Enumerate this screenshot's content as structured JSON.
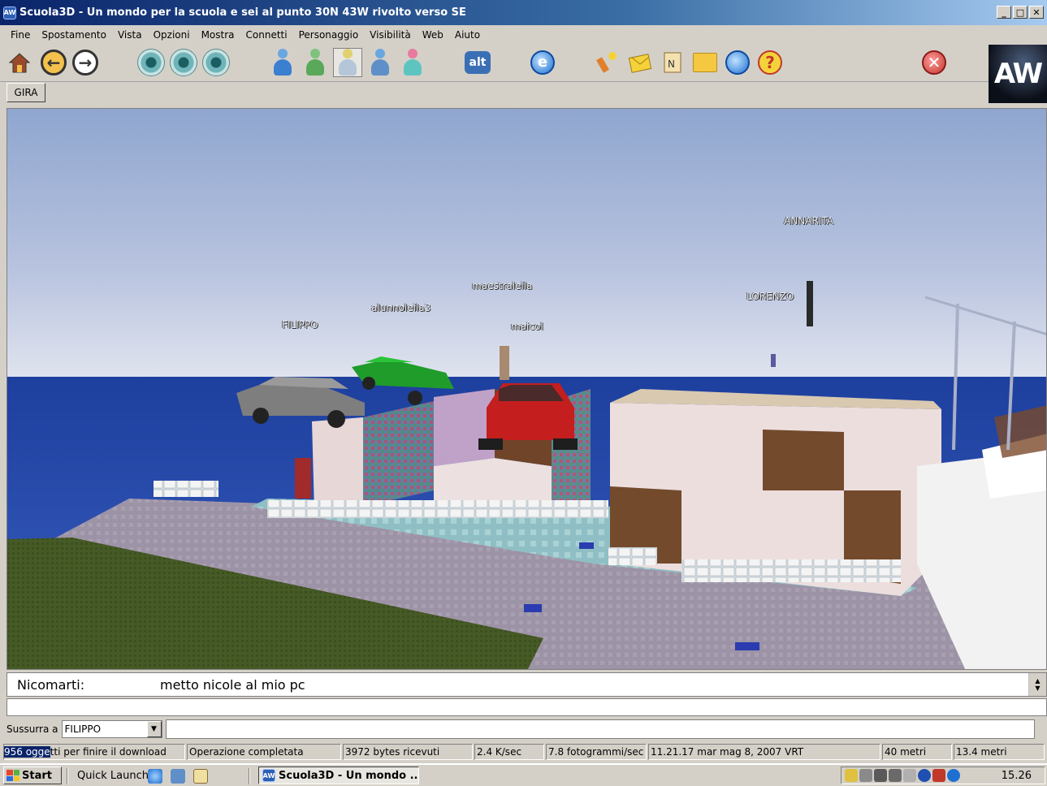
{
  "window": {
    "title": "Scuola3D - Un mondo per la scuola e sei al punto 30N 43W rivolto verso SE",
    "icon_text": "AW",
    "controls": {
      "minimize": "_",
      "maximize": "□",
      "close": "✕"
    }
  },
  "menu": [
    "Fine",
    "Spostamento",
    "Vista",
    "Opzioni",
    "Mostra",
    "Connetti",
    "Personaggio",
    "Visibilità",
    "Web",
    "Aiuto"
  ],
  "toolbar": {
    "icons": [
      "home-icon",
      "back-icon",
      "forward-icon",
      "view-first-person-icon",
      "view-third-person-icon",
      "view-front-icon",
      "avatar-icon",
      "avatar-look-icon",
      "avatar-select-icon",
      "contacts-icon",
      "telegram-icon",
      "alt-icon",
      "web-browser-icon",
      "fireworks-icon",
      "world-mail-icon",
      "map-icon",
      "folder-icon",
      "teleport-icon",
      "help-icon",
      "stop-icon"
    ],
    "alt_label": "alt",
    "logo_text": "AW"
  },
  "gira_button": "GIRA",
  "scene": {
    "avatar_names": [
      "ANNARITA",
      "LORENZO",
      "maestraleila",
      "alunnoleila3",
      "maicol",
      "FILIPPO"
    ]
  },
  "chat": {
    "sender": "Nicomarti:",
    "message": "metto nicole al mio pc",
    "input_value": ""
  },
  "whisper": {
    "label": "Sussurra a",
    "selected": "FILIPPO",
    "input_value": ""
  },
  "status": {
    "download_count": "956 ogge",
    "download_rest": "tti per finire il download",
    "operation": "Operazione completata",
    "bytes": "3972 bytes ricevuti",
    "rate": "2.4 K/sec",
    "fps": "7.8 fotogrammi/sec",
    "datetime": "11.21.17 mar mag 8, 2007 VRT",
    "distance1": "40 metri",
    "distance2": "13.4 metri"
  },
  "taskbar": {
    "start": "Start",
    "quick_launch": "Quick Launch",
    "task": "Scuola3D - Un mondo ...",
    "clock": "15.26"
  },
  "colors": {
    "titlebar_start": "#0a246a",
    "titlebar_end": "#a6caf0",
    "face": "#d4d0c8",
    "highlight": "#0a246a"
  }
}
